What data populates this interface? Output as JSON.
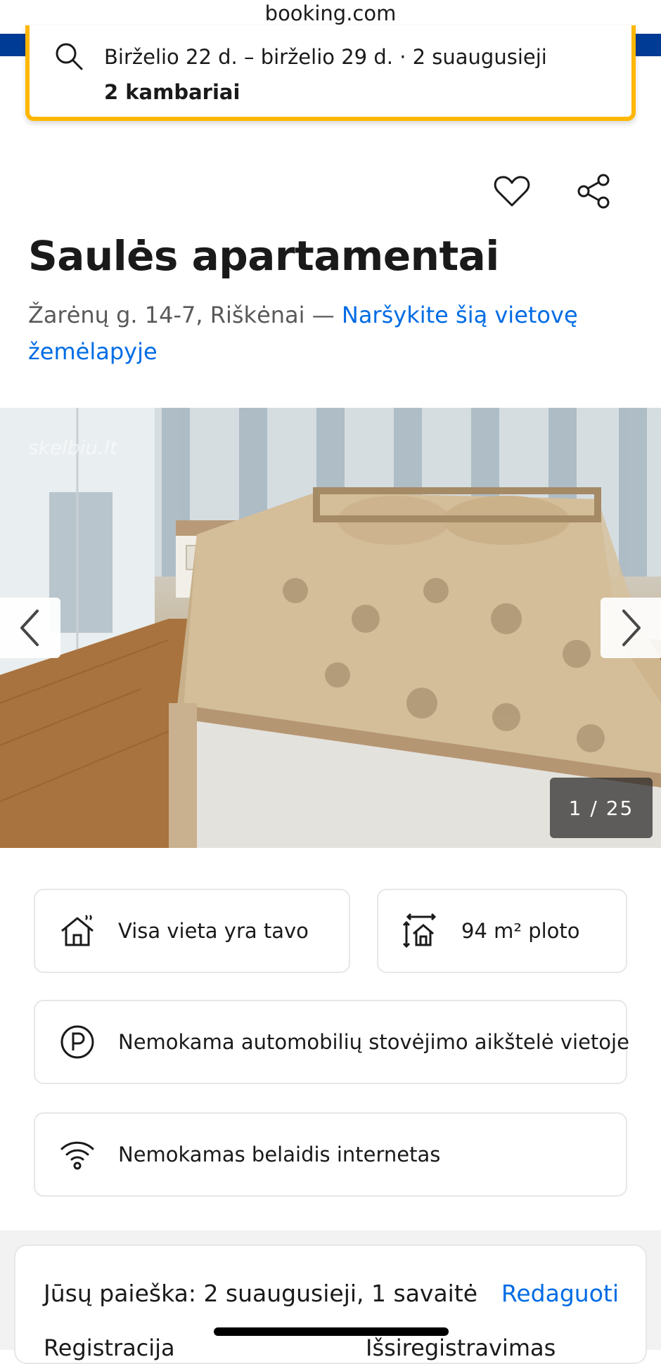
{
  "browser": {
    "url": "booking.com"
  },
  "watermark": "skelbiu.lt",
  "search": {
    "line1": "Birželio 22 d. – birželio 29 d.  ·  2 suaugusieji",
    "line2": "2 kambariai"
  },
  "actions": {
    "save_icon": "heart-icon",
    "share_icon": "share-icon"
  },
  "property": {
    "title": "Saulės apartamentai",
    "address": "Žarėnų g. 14-7, Riškėnai —",
    "map_link": "Naršykite šią vietovę žemėlapyje"
  },
  "gallery": {
    "counter": "1 / 25",
    "prev_icon": "chevron-left-icon",
    "next_icon": "chevron-right-icon"
  },
  "features": [
    {
      "icon": "house-icon",
      "label": "Visa vieta yra tavo"
    },
    {
      "icon": "size-icon",
      "label": "94 m² ploto"
    },
    {
      "icon": "parking-icon",
      "label": "Nemokama automobilių stovėjimo aikštelė vietoje"
    },
    {
      "icon": "wifi-icon",
      "label": "Nemokamas belaidis internetas"
    }
  ],
  "summary": {
    "text": "Jūsų paieška: 2 suaugusieji, 1 savaitė",
    "edit": "Redaguoti",
    "checkin_cut": "Registracija",
    "checkout_cut": "Išsiregistravimas"
  },
  "colors": {
    "brand_blue": "#003b95",
    "accent_yellow": "#ffb700",
    "link_blue": "#006ce4"
  }
}
